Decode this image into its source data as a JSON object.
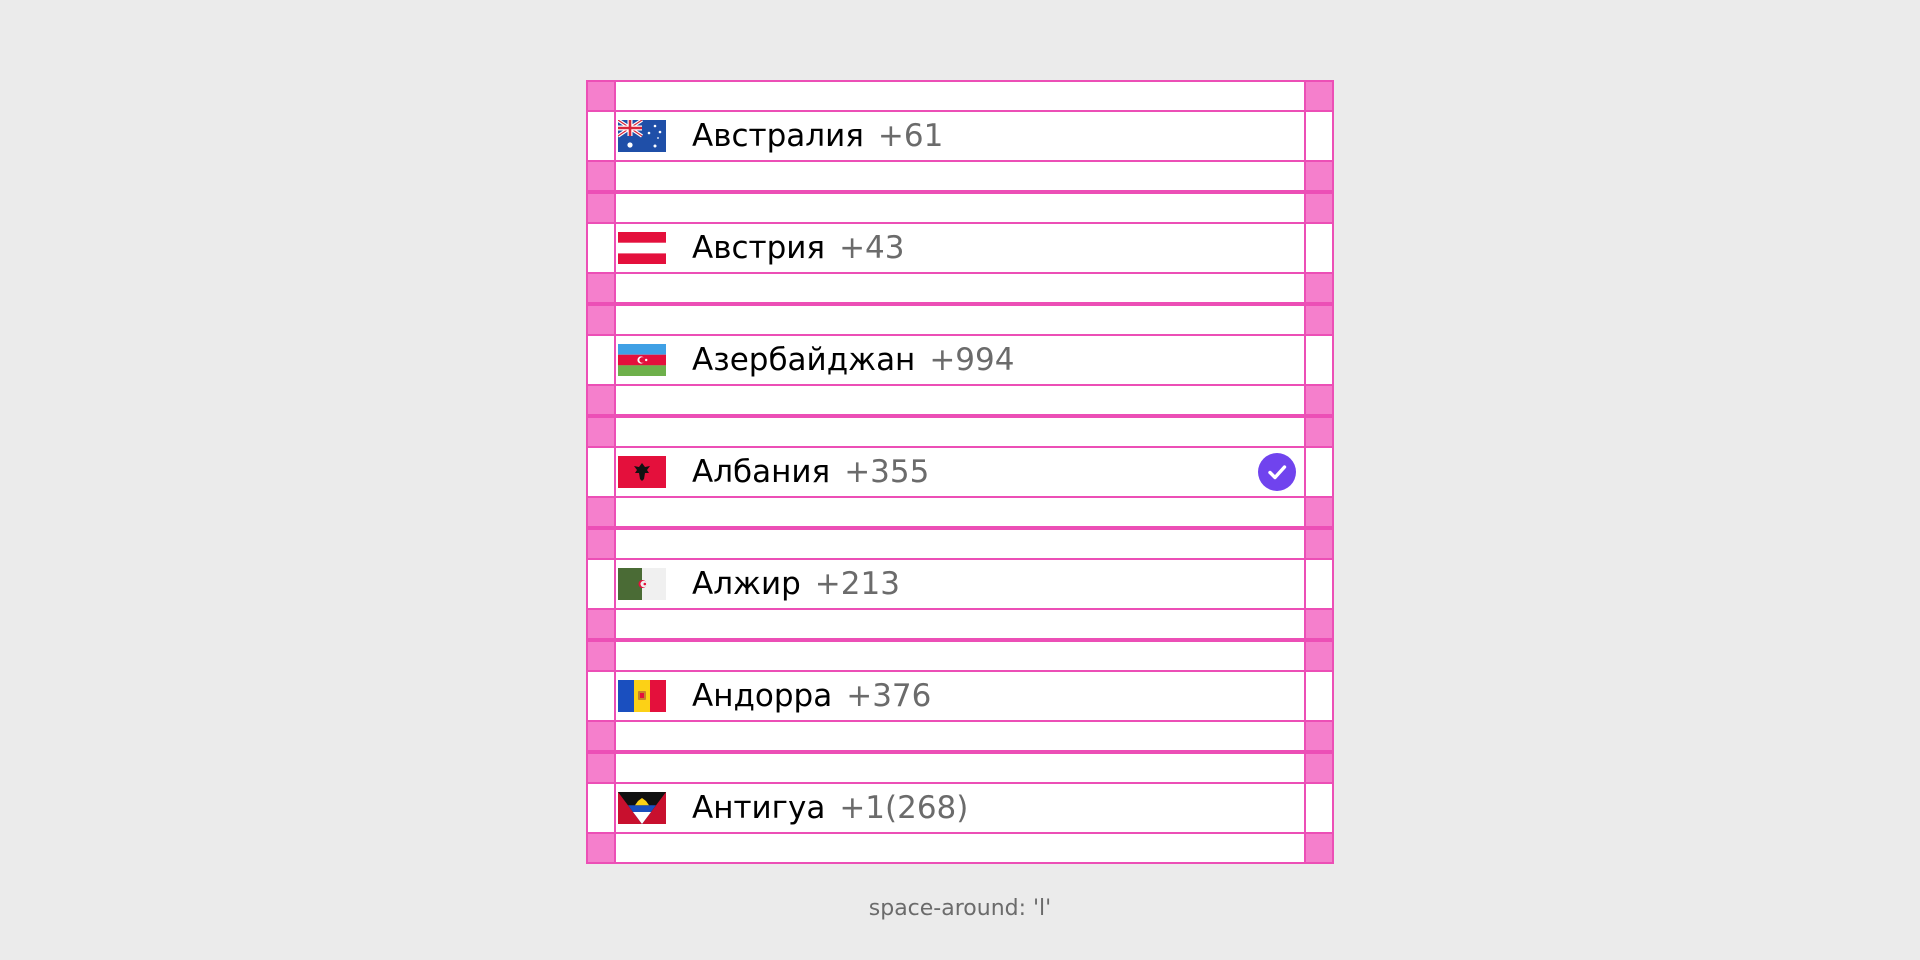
{
  "countries": [
    {
      "name": "Австралия",
      "code": "+61"
    },
    {
      "name": "Австрия",
      "code": "+43"
    },
    {
      "name": "Азербайджан",
      "code": "+994"
    },
    {
      "name": "Албания",
      "code": "+355",
      "selected": true
    },
    {
      "name": "Алжир",
      "code": "+213"
    },
    {
      "name": "Андорра",
      "code": "+376"
    },
    {
      "name": "Антигуа",
      "code": "+1(268)"
    }
  ],
  "caption": "space-around: 'l'",
  "colors": {
    "guide_border": "#ec4fb6",
    "guide_fill": "#f57fcc",
    "check_badge": "#7043ee",
    "code_text": "#6b6b6b"
  },
  "icons": {
    "selected": "checkmark-icon"
  }
}
